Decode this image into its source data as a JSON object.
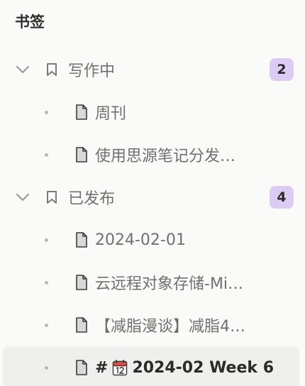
{
  "panel": {
    "title": "书签"
  },
  "groups": [
    {
      "label": "写作中",
      "count": "2",
      "items": [
        {
          "label": "周刊"
        },
        {
          "label": "使用思源笔记分发…"
        }
      ]
    },
    {
      "label": "已发布",
      "count": "4",
      "items": [
        {
          "label": "2024-02-01"
        },
        {
          "label": "云远程对象存储-Mi…"
        },
        {
          "label": "【减脂漫谈】减脂4…"
        },
        {
          "label": "2024-02 Week 6",
          "prefix": "#"
        }
      ]
    }
  ],
  "colors": {
    "badge": "#dccbf3",
    "selected_row": "#efefed"
  }
}
